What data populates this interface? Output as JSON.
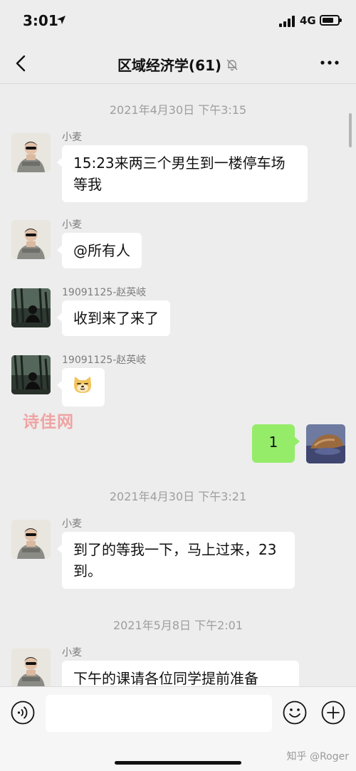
{
  "status_bar": {
    "time": "3:01",
    "network": "4G"
  },
  "nav": {
    "title": "区域经济学(61)"
  },
  "chat": {
    "timestamps": [
      "2021年4月30日 下午3:15",
      "2021年4月30日 下午3:21",
      "2021年5月8日 下午2:01"
    ],
    "messages": [
      {
        "sender": "小麦",
        "text": "15:23来两三个男生到一楼停车场等我"
      },
      {
        "sender": "小麦",
        "text": "@所有人"
      },
      {
        "sender": "19091125-赵英岐",
        "text": "收到来了来了"
      },
      {
        "sender": "19091125-赵英岐",
        "sticker": "dog-face-sticker"
      },
      {
        "mine": true,
        "text": "1"
      },
      {
        "sender": "小麦",
        "text": "到了的等我一下，马上过来，23到。"
      },
      {
        "sender": "小麦",
        "text": "下午的课请各位同学提前准备"
      }
    ],
    "watermark": "诗佳网"
  },
  "input_bar": {
    "value": "",
    "credit": "知乎 @Roger"
  },
  "colors": {
    "background": "#ededed",
    "my_bubble": "#95ec69",
    "other_bubble": "#ffffff",
    "timestamp": "#9e9e9e",
    "watermark": "#f0a3a3"
  },
  "icons": [
    "back-icon",
    "mute-icon",
    "more-icon",
    "voice-icon",
    "emoji-icon",
    "plus-icon"
  ]
}
